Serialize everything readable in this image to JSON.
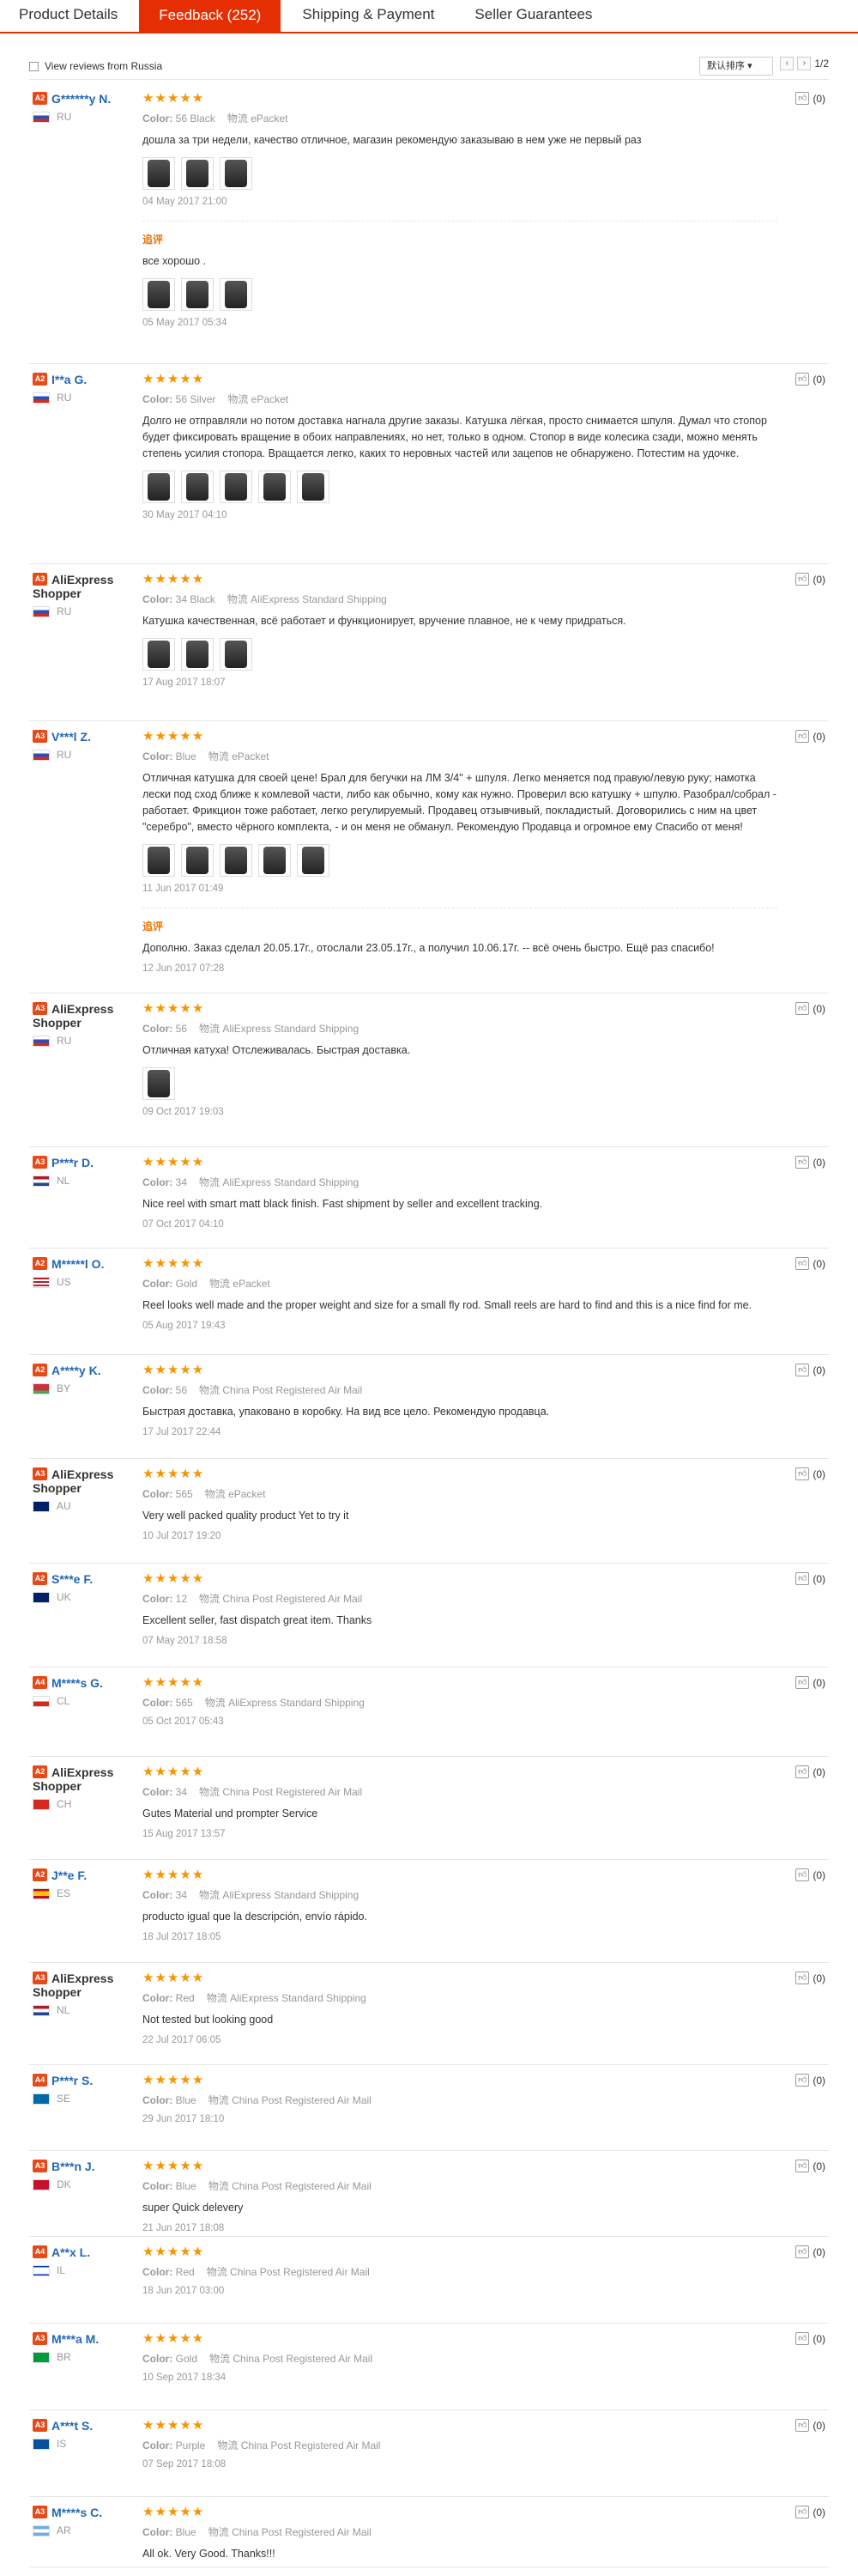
{
  "tabs": [
    {
      "label": "Product Details",
      "active": false
    },
    {
      "label": "Feedback (252)",
      "active": true
    },
    {
      "label": "Shipping & Payment",
      "active": false
    },
    {
      "label": "Seller Guarantees",
      "active": false
    }
  ],
  "toolbar": {
    "filter_label": "View reviews from Russia",
    "sort_label": "默认排序",
    "page_indicator": "1/2"
  },
  "labels": {
    "color": "Color:",
    "ship": "物流",
    "additional": "追评"
  },
  "colors": {
    "accent": "#e62e04",
    "stars": "#f79400",
    "username": "#2367b6",
    "level_badge": "#e64a19"
  },
  "reviews": [
    {
      "level": "A2",
      "name": "G******y N.",
      "country": "RU",
      "color": "56 Black",
      "shipping": "ePacket",
      "text": "дошла за три недели, качество отличное, магазин рекомендую заказываю в нем уже не первый раз",
      "photos": 3,
      "date": "04 May 2017 21:00",
      "helpful": "(0)",
      "followup": {
        "text": "все хорошо .",
        "photos": 3,
        "date": "05 May 2017 05:34"
      }
    },
    {
      "level": "A2",
      "name": "I**a G.",
      "country": "RU",
      "color": "56 Silver",
      "shipping": "ePacket",
      "text": "Долго не отправляли но потом доставка нагнала другие заказы. Катушка лёгкая, просто снимается шпуля. Думал что стопор будет фиксировать вращение в обоих направлениях, но нет, только в одном. Стопор в виде колесика сзади, можно менять степень усилия стопора. Вращается легко, каких то неровных частей или зацепов не обнаружено. Потестим на удочке.",
      "photos": 5,
      "date": "30 May 2017 04:10",
      "helpful": "(0)"
    },
    {
      "level": "A3",
      "name": "AliExpress Shopper",
      "country": "RU",
      "color": "34 Black",
      "shipping": "AliExpress Standard Shipping",
      "text": "Катушка качественная, всё работает и функционирует, вручение плавное, не к чему придраться.",
      "photos": 3,
      "date": "17 Aug 2017 18:07",
      "helpful": "(0)"
    },
    {
      "level": "A3",
      "name": "V***l Z.",
      "country": "RU",
      "color": "Blue",
      "shipping": "ePacket",
      "text": "Отличная катушка для своей цене! Брал для бегучки на ЛМ 3/4\" + шпуля. Легко меняется под правую/левую руку; намотка лески под сход ближе к комлевой части, либо как обычно, кому как нужно. Проверил всю катушку + шпулю. Разобрал/собрал - работает. Фрикцион тоже работает, легко регулируемый. Продавец отзывчивый, покладистый. Договорились с ним на цвет \"серебро\", вместо чёрного комплекта, - и он меня не обманул. Рекомендую Продавца и огромное ему Спасибо от меня!",
      "photos": 5,
      "date": "11 Jun 2017 01:49",
      "helpful": "(0)",
      "followup": {
        "text": "Дополню. Заказ сделал 20.05.17г., отослали 23.05.17г., а получил 10.06.17г. -- всё очень быстро. Ещё раз спасибо!",
        "photos": 0,
        "date": "12 Jun 2017 07:28"
      }
    },
    {
      "level": "A3",
      "name": "AliExpress Shopper",
      "country": "RU",
      "color": "56",
      "shipping": "AliExpress Standard Shipping",
      "text": "Отличная катуха! Отслеживалась. Быстрая доставка.",
      "photos": 1,
      "date": "09 Oct 2017 19:03",
      "helpful": "(0)"
    },
    {
      "level": "A3",
      "name": "P***r D.",
      "country": "NL",
      "color": "34",
      "shipping": "AliExpress Standard Shipping",
      "text": "Nice reel with smart matt black finish. Fast shipment by seller and excellent tracking.",
      "photos": 0,
      "date": "07 Oct 2017 04:10",
      "helpful": "(0)"
    },
    {
      "level": "A2",
      "name": "M*****l O.",
      "country": "US",
      "color": "Gold",
      "shipping": "ePacket",
      "text": "Reel looks well made and the proper weight and size for a small fly rod. Small reels are hard to find and this is a nice find for me.",
      "photos": 0,
      "date": "05 Aug 2017 19:43",
      "helpful": "(0)"
    },
    {
      "level": "A2",
      "name": "A****y K.",
      "country": "BY",
      "color": "56",
      "shipping": "China Post Registered Air Mail",
      "text": "Быстрая доставка, упаковано в коробку. На вид все цело. Рекомендую продавца.",
      "photos": 0,
      "date": "17 Jul 2017 22:44",
      "helpful": "(0)"
    },
    {
      "level": "A3",
      "name": "AliExpress Shopper",
      "country": "AU",
      "color": "565",
      "shipping": "ePacket",
      "text": "Very well packed quality product Yet to try it",
      "photos": 0,
      "date": "10 Jul 2017 19:20",
      "helpful": "(0)"
    },
    {
      "level": "A2",
      "name": "S***e F.",
      "country": "UK",
      "color": "12",
      "shipping": "China Post Registered Air Mail",
      "text": "Excellent seller, fast dispatch great item. Thanks",
      "photos": 0,
      "date": "07 May 2017 18:58",
      "helpful": "(0)"
    },
    {
      "level": "A4",
      "name": "M****s G.",
      "country": "CL",
      "color": "565",
      "shipping": "AliExpress Standard Shipping",
      "text": "",
      "photos": 0,
      "date": "05 Oct 2017 05:43",
      "helpful": "(0)"
    },
    {
      "level": "A2",
      "name": "AliExpress Shopper",
      "country": "CH",
      "color": "34",
      "shipping": "China Post Registered Air Mail",
      "text": "Gutes Material und prompter Service",
      "photos": 0,
      "date": "15 Aug 2017 13:57",
      "helpful": "(0)"
    },
    {
      "level": "A2",
      "name": "J**e F.",
      "country": "ES",
      "color": "34",
      "shipping": "AliExpress Standard Shipping",
      "text": "producto igual que la descripción, envío rápido.",
      "photos": 0,
      "date": "18 Jul 2017 18:05",
      "helpful": "(0)"
    },
    {
      "level": "A3",
      "name": "AliExpress Shopper",
      "country": "NL",
      "color": "Red",
      "shipping": "AliExpress Standard Shipping",
      "text": "Not tested but looking good",
      "photos": 0,
      "date": "22 Jul 2017 06:05",
      "helpful": "(0)"
    },
    {
      "level": "A4",
      "name": "P***r S.",
      "country": "SE",
      "color": "Blue",
      "shipping": "China Post Registered Air Mail",
      "text": "",
      "photos": 0,
      "date": "29 Jun 2017 18:10",
      "helpful": "(0)"
    },
    {
      "level": "A3",
      "name": "B***n J.",
      "country": "DK",
      "color": "Blue",
      "shipping": "China Post Registered Air Mail",
      "text": "super Quick delevery",
      "photos": 0,
      "date": "21 Jun 2017 18:08",
      "helpful": "(0)"
    },
    {
      "level": "A4",
      "name": "A**x L.",
      "country": "IL",
      "color": "Red",
      "shipping": "China Post Registered Air Mail",
      "text": "",
      "photos": 0,
      "date": "18 Jun 2017 03:00",
      "helpful": "(0)"
    },
    {
      "level": "A3",
      "name": "M***a M.",
      "country": "BR",
      "color": "Gold",
      "shipping": "China Post Registered Air Mail",
      "text": "",
      "photos": 0,
      "date": "10 Sep 2017 18:34",
      "helpful": "(0)"
    },
    {
      "level": "A3",
      "name": "A***t S.",
      "country": "IS",
      "color": "Purple",
      "shipping": "China Post Registered Air Mail",
      "text": "",
      "photos": 0,
      "date": "07 Sep 2017 18:08",
      "helpful": "(0)"
    },
    {
      "level": "A3",
      "name": "M****s C.",
      "country": "AR",
      "color": "Blue",
      "shipping": "China Post Registered Air Mail",
      "text": "All ok. Very Good. Thanks!!!",
      "photos": 0,
      "date": "",
      "helpful": "(0)"
    }
  ]
}
